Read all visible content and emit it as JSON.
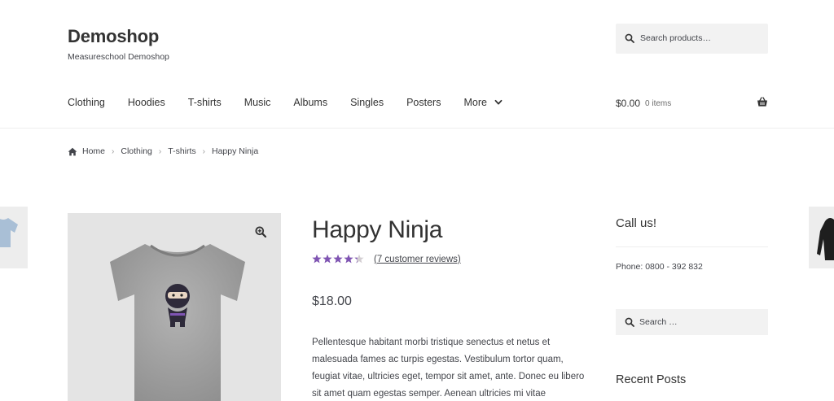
{
  "site": {
    "title": "Demoshop",
    "description": "Measureschool Demoshop"
  },
  "header_search": {
    "placeholder": "Search products…"
  },
  "nav": {
    "items": [
      {
        "label": "Clothing"
      },
      {
        "label": "Hoodies"
      },
      {
        "label": "T-shirts"
      },
      {
        "label": "Music"
      },
      {
        "label": "Albums"
      },
      {
        "label": "Singles"
      },
      {
        "label": "Posters"
      },
      {
        "label": "More"
      }
    ]
  },
  "cart": {
    "amount": "$0.00",
    "count": "0 items",
    "icon": "basket-icon"
  },
  "breadcrumb": {
    "items": [
      "Home",
      "Clothing",
      "T-shirts",
      "Happy Ninja"
    ],
    "separator": "›"
  },
  "product": {
    "title": "Happy Ninja",
    "rating": 4.3,
    "rating_max": 5,
    "reviews_label": "(7 customer reviews)",
    "price": "$18.00",
    "description": "Pellentesque habitant morbi tristique senectus et netus et malesuada fames ac turpis egestas. Vestibulum tortor quam, feugiat vitae, ultricies eget, tempor sit amet, ante. Donec eu libero sit amet quam egestas semper. Aenean ultricies mi vitae"
  },
  "sidebar": {
    "call_title": "Call us!",
    "phone": "Phone: 0800 - 392 832",
    "search_placeholder": "Search …",
    "recent_title": "Recent Posts"
  },
  "colors": {
    "accent_star": "#7f54b3",
    "text": "#43454b",
    "heading": "#333333",
    "panel_bg": "#f2f2f2",
    "image_bg": "#e4e4e4"
  }
}
